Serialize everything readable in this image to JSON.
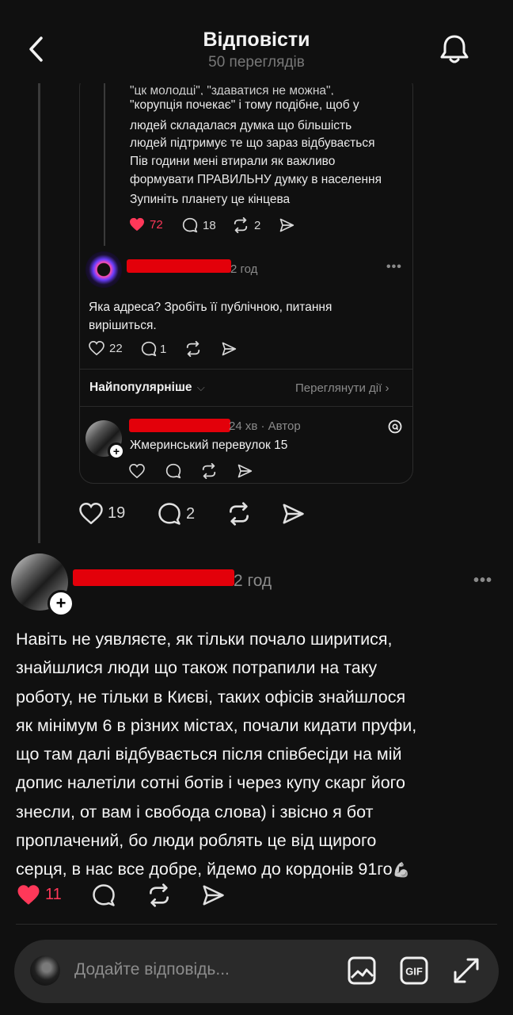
{
  "header": {
    "title": "Відповісти",
    "subtitle": "50 переглядів"
  },
  "quoted_post": {
    "lines": [
      "\"корупція почекає\" і тому подібне, щоб у",
      "людей складалася думка що більшість",
      "людей підтримує те що зараз відбувається",
      "Пів години мені втирали як важливо",
      "формувати ПРАВИЛЬНУ думку в населення",
      "Зупиніть планету це кінцева"
    ],
    "likes": "72",
    "replies": "18",
    "reposts": "2"
  },
  "nested_reply": {
    "time": "2 год",
    "text_lines": [
      "Яка адреса? Зробіть її публічною, питання",
      "вирішиться."
    ],
    "likes": "22",
    "replies": "1"
  },
  "sort_bar": {
    "label": "Найпопулярніше",
    "activity": "Переглянути дії"
  },
  "author_reply": {
    "time": "24 хв · Автор",
    "text": "Жмеринський перевулок 15"
  },
  "outer_actions": {
    "likes": "19",
    "replies": "2"
  },
  "main_post": {
    "time": "2 год",
    "lines": [
      "Навіть не уявляєте, як тільки почало ширитися,",
      "знайшлися люди що також потрапили на таку",
      "роботу, не тільки в Києві, таких офісів знайшлося",
      "як мінімум 6 в різних містах, почали кидати пруфи,",
      "що там далі відбувається після співбесіди на мій",
      "допис налетіли сотні ботів і через купу скарг його",
      "знесли, от вам і свобода слова) і звісно я бот",
      "проплачений, бо люди роблять це від щирого",
      "серця, в нас все добре, йдемо до кордонів 91го"
    ],
    "emoji": "💪",
    "likes": "11"
  },
  "composer": {
    "placeholder": "Додайте відповідь..."
  },
  "colors": {
    "background": "#101010",
    "like_red": "#ff3859",
    "redaction": "#e3000a"
  },
  "icons": [
    "back-arrow-icon",
    "bell-icon",
    "heart-icon",
    "comment-icon",
    "repost-icon",
    "share-icon",
    "more-icon",
    "threads-logo-icon",
    "image-icon",
    "gif-icon",
    "expand-icon"
  ]
}
